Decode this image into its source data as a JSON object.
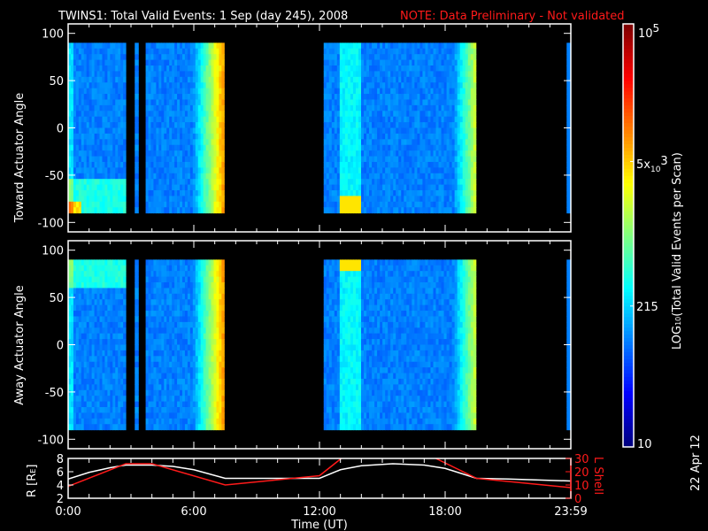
{
  "title": "TWINS1: Total Valid Events:  1 Sep (day 245), 2008",
  "note": "NOTE: Data Preliminary - Not validated",
  "date_stamp": "22 Apr 12",
  "chart_data": [
    {
      "type": "heatmap",
      "ylabel": "Toward Actuator Angle",
      "ylim": [
        -110,
        110
      ],
      "yticks": [
        "100",
        "50",
        "0",
        "-50",
        "-100"
      ],
      "ytick_values": [
        100,
        50,
        0,
        -50,
        -100
      ],
      "data_range": [
        -90,
        90
      ],
      "blocks_hours": [
        [
          0,
          2.75
        ],
        [
          3.18,
          3.35
        ],
        [
          3.7,
          7.45
        ],
        [
          12.2,
          19.47
        ],
        [
          23.8,
          24
        ]
      ],
      "enhancement": "bottom"
    },
    {
      "type": "heatmap",
      "ylabel": "Away Actuator Angle",
      "ylim": [
        -110,
        110
      ],
      "yticks": [
        "100",
        "50",
        "0",
        "-50",
        "-100"
      ],
      "ytick_values": [
        100,
        50,
        0,
        -50,
        -100
      ],
      "data_range": [
        -90,
        90
      ],
      "blocks_hours": [
        [
          0,
          2.75
        ],
        [
          3.18,
          3.35
        ],
        [
          3.7,
          7.45
        ],
        [
          12.2,
          19.47
        ],
        [
          23.8,
          24
        ]
      ],
      "enhancement": "top"
    },
    {
      "type": "line",
      "xlabel": "Time (UT)",
      "xticks": [
        "0:00",
        "6:00",
        "12:00",
        "18:00",
        "23:59"
      ],
      "xtick_hours": [
        0,
        6,
        12,
        18,
        24
      ],
      "ylabel": "R [R",
      "ylabel_sub": "E",
      "ylabel_end": "]",
      "yticks": [
        "8",
        "6",
        "4",
        "2"
      ],
      "ytick_values": [
        8,
        6,
        4,
        2
      ],
      "ylim": [
        2,
        8
      ],
      "y2label": "L Shell",
      "y2ticks": [
        "30",
        "20",
        "10",
        "0"
      ],
      "y2tick_values": [
        30,
        20,
        10,
        0
      ],
      "y2lim": [
        0,
        30
      ],
      "series": [
        {
          "name": "R",
          "color": "#ffffff",
          "x": [
            0,
            1,
            2,
            2.75,
            4,
            5,
            6,
            7.5,
            12,
            13,
            14,
            15.5,
            17,
            18,
            19.5,
            21,
            24
          ],
          "y": [
            4.9,
            5.9,
            6.6,
            7,
            7,
            6.8,
            6.3,
            5,
            5,
            6.3,
            6.9,
            7.2,
            7,
            6.5,
            5,
            4.9,
            4.6
          ]
        },
        {
          "name": "L Shell",
          "color": "#ff1a1a",
          "x": [
            0,
            2.75,
            4,
            7.5,
            12,
            13.2,
            17.3,
            19.5,
            24
          ],
          "y": [
            9,
            26,
            26,
            10,
            17,
            32,
            32,
            15,
            8
          ]
        }
      ]
    },
    {
      "type": "colorbar",
      "label": "LOG",
      "label_sub": "10",
      "label_end": "(Total Valid Events per Scan)",
      "ticks": [
        "10",
        "215",
        "5x",
        "10",
        "3",
        "10",
        "5"
      ],
      "tick_values": [
        10,
        215,
        5000,
        100000
      ],
      "range": [
        10,
        100000
      ]
    }
  ]
}
